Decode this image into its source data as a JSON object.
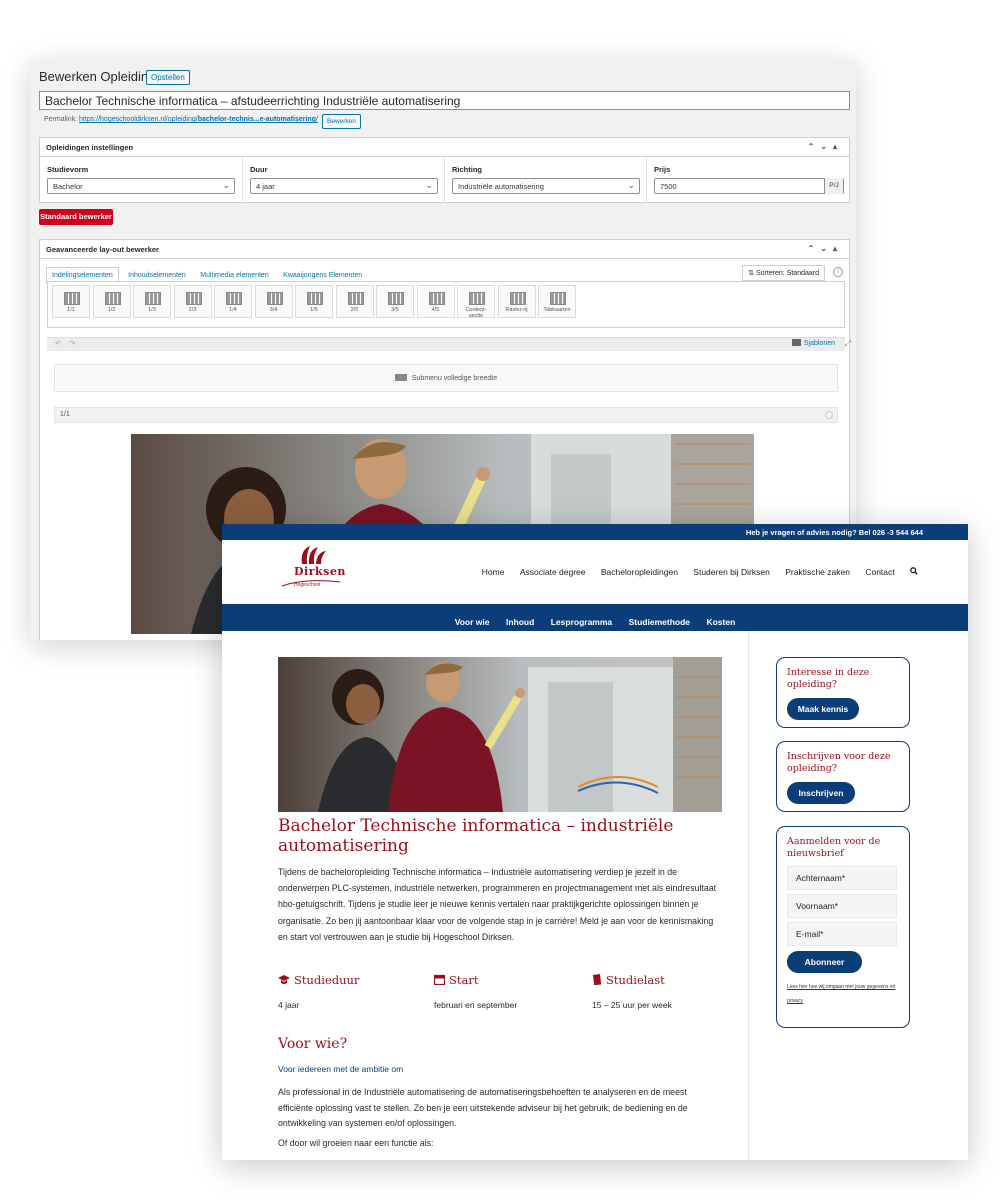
{
  "admin": {
    "page_title": "Bewerken Opleiding",
    "new_button": "Opstellen",
    "post_title": "Bachelor Technische informatica – afstudeerrichting Industriële automatisering",
    "permalink_label": "Permalink:",
    "permalink_base": "https://hogeschooldirksen.nl/opleiding/",
    "permalink_slug": "bachelor-technis...e-automatisering",
    "permalink_end": "/",
    "permalink_edit": "Bewerken",
    "settings_box": {
      "title": "Opleidingen instellingen",
      "fields": [
        {
          "label": "Studievorm",
          "value": "Bachelor"
        },
        {
          "label": "Duur",
          "value": "4 jaar"
        },
        {
          "label": "Richting",
          "value": "Industriële automatisering"
        },
        {
          "label": "Prijs",
          "value": "7500",
          "suffix": "P/J"
        }
      ]
    },
    "default_editor_button": "Standaard bewerker",
    "layout_box": {
      "title": "Geavanceerde lay-out bewerker",
      "tabs": [
        "Indelingselementen",
        "Inhoudselementen",
        "Multimedia elementen",
        "Kwaaijongens Elementen"
      ],
      "sort_label": "Sorteren: Standaard",
      "elements": [
        "1/1",
        "1/2",
        "1/3",
        "2/3",
        "1/4",
        "3/4",
        "1/5",
        "2/5",
        "3/5",
        "4/5",
        "Content-\nsectie",
        "Raster-rij",
        "Tabkaarten"
      ],
      "templates_label": "Sjablonen",
      "submenu_label": "Submenu volledige breedte",
      "row_label": "1/1"
    }
  },
  "site": {
    "topbar_text": "Heb je vragen of advies nodig? Bel 026 -3 544 644",
    "logo_name": "Dirksen",
    "logo_sub": "Hogeschool",
    "main_nav": [
      "Home",
      "Associate degree",
      "Bacheloropleidingen",
      "Studeren bij Dirksen",
      "Praktische zaken",
      "Contact"
    ],
    "sub_nav": [
      "Voor wie",
      "Inhoud",
      "Lesprogramma",
      "Studiemethode",
      "Kosten"
    ],
    "heading": "Bachelor Technische informatica – industriële automatisering",
    "intro": "Tijdens de bacheloropleiding Technische informatica – Industriële automatisering verdiep je jezelf in de onderwerpen PLC-systemen, industriële netwerken, programmeren en projectmanagement met als eindresultaat hbo-getuigschrift. Tijdens je studie leer je nieuwe kennis vertalen naar praktijkgerichte oplossingen binnen je organisatie. Zo ben jij aantoonbaar klaar voor de volgende stap in je carrière! Meld je aan voor de kennismaking en start vol vertrouwen aan je studie bij Hogeschool Dirksen.",
    "facts": [
      {
        "title": "Studieduur",
        "value": "4 jaar",
        "icon": "graduation-cap-icon"
      },
      {
        "title": "Start",
        "value": "februari en september",
        "icon": "calendar-icon"
      },
      {
        "title": "Studielast",
        "value": "15 – 25 uur per week",
        "icon": "book-icon"
      }
    ],
    "section_title": "Voor wie?",
    "section_lead": "Voor iedereen met de ambitie om",
    "section_body": "Als professional in de Industriële automatisering de automatiseringsbehoeften te analyseren en de meest efficiënte oplossing vast te stellen. Zo ben je een uitstekende adviseur bij het gebruik, de bediening en de ontwikkeling van systemen en/of oplossingen.",
    "section_body2": "Of door wil groeien naar een functie als:",
    "sidebar": {
      "card1_title": "Interesse in deze opleiding?",
      "card1_button": "Maak kennis",
      "card2_title": "Inschrijven voor deze opleiding?",
      "card2_button": "Inschrijven",
      "card3_title": "Aanmelden voor de nieuwsbrief",
      "lastname_placeholder": "Achternaam*",
      "firstname_placeholder": "Voornaam*",
      "email_placeholder": "E-mail*",
      "subscribe_button": "Abonneer",
      "privacy_text": "Lees hier hoe wij omgaan met jouw gegevens en privacy"
    }
  },
  "colors": {
    "brand_blue": "#0b3d79",
    "brand_red": "#9a0e1c",
    "wp_blue": "#0073aa",
    "wp_red_button": "#d0021b"
  }
}
